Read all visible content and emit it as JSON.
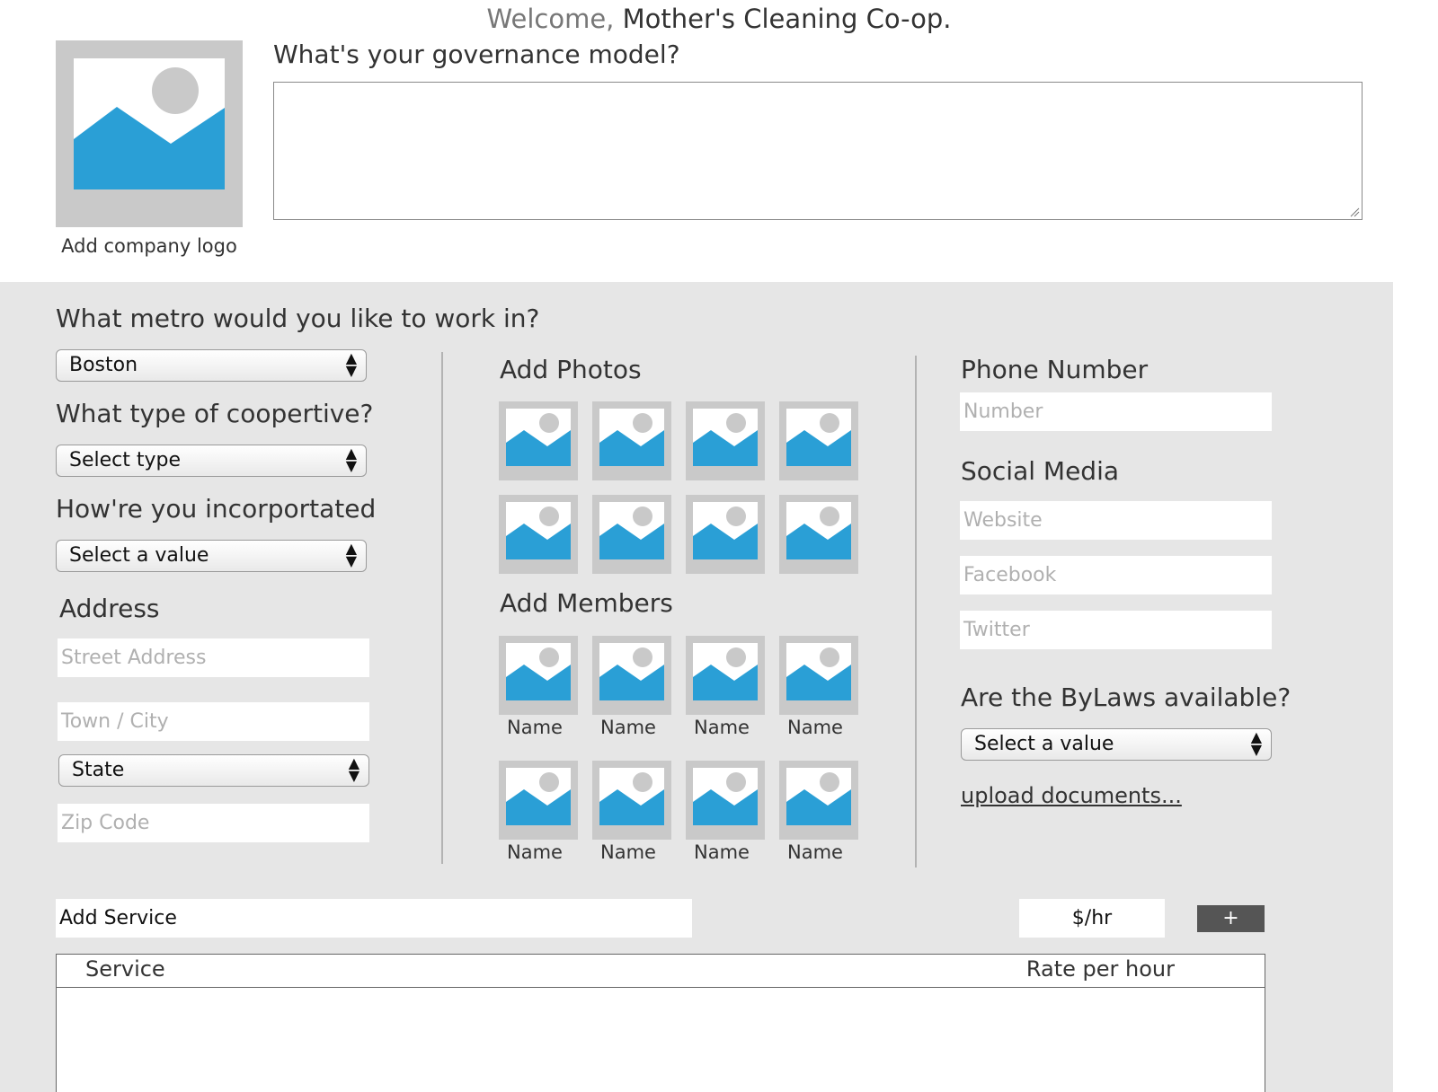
{
  "header": {
    "welcome_prefix": "Welcome,",
    "company_name": "Mother's Cleaning Co-op.",
    "logo_label": "Add company logo",
    "governance_question": "What's your governance model?",
    "governance_value": ""
  },
  "left_column": {
    "metro_question": "What metro would you like to work in?",
    "metro_value": "Boston",
    "coop_type_question": "What type of coopertive?",
    "coop_type_value": "Select type",
    "incorporation_question": "How're you incorportated",
    "incorporation_value": "Select a value",
    "address_heading": "Address",
    "street_placeholder": "Street Address",
    "town_placeholder": "Town / City",
    "state_value": "State",
    "zip_placeholder": "Zip Code"
  },
  "middle_column": {
    "photos_heading": "Add Photos",
    "members_heading": "Add Members",
    "member_names": [
      "Name",
      "Name",
      "Name",
      "Name",
      "Name",
      "Name",
      "Name",
      "Name"
    ]
  },
  "right_column": {
    "phone_heading": "Phone Number",
    "phone_placeholder": "Number",
    "social_heading": "Social Media",
    "website_placeholder": "Website",
    "facebook_placeholder": "Facebook",
    "twitter_placeholder": "Twitter",
    "bylaws_question": "Are the ByLaws available?",
    "bylaws_value": "Select a value",
    "upload_link": "upload documents..."
  },
  "services": {
    "add_service_value": "Add Service",
    "rate_value": "$/hr",
    "add_button_label": "+",
    "table_headers": [
      "Service",
      "Rate per hour"
    ]
  },
  "icons": {
    "image_placeholder": "image-placeholder-icon",
    "select_arrows": "up-down-arrow-icon",
    "resize_grip": "resize-grip-icon"
  },
  "colors": {
    "accent_blue": "#2a9fd6",
    "panel_grey": "#e6e6e6",
    "placeholder_grey": "#c9c9c9"
  }
}
